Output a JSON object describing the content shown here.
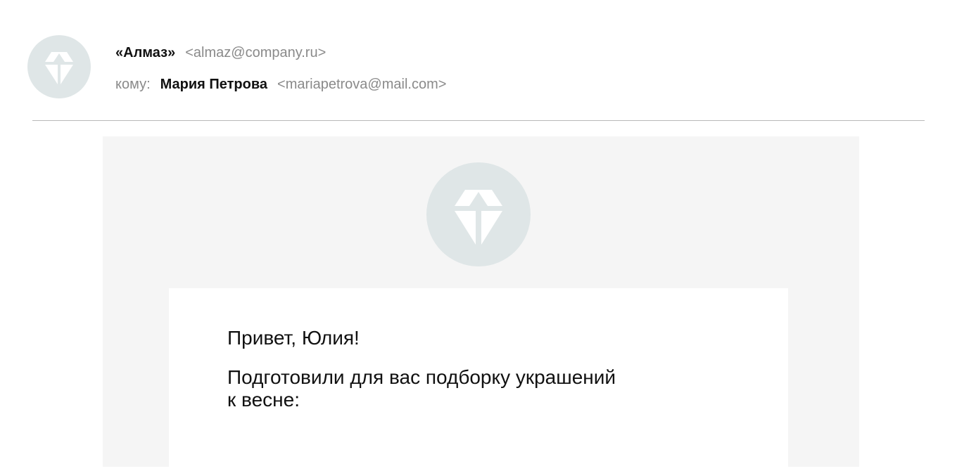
{
  "sender": {
    "name": "«Алмаз»",
    "email": "<almaz@company.ru>",
    "avatar_icon": "diamond-icon"
  },
  "recipient": {
    "label": "кому:",
    "name": "Мария Петрова",
    "email": "<mariapetrova@mail.com>"
  },
  "email_body": {
    "logo_icon": "diamond-icon",
    "greeting": "Привет, Юлия!",
    "intro": "Подготовили для вас подборку украшений к весне:"
  },
  "colors": {
    "avatar_bg": "#dfe6e7",
    "body_bg": "#f5f5f5",
    "muted_text": "#8a8a8a",
    "divider": "#b9b9b9"
  }
}
